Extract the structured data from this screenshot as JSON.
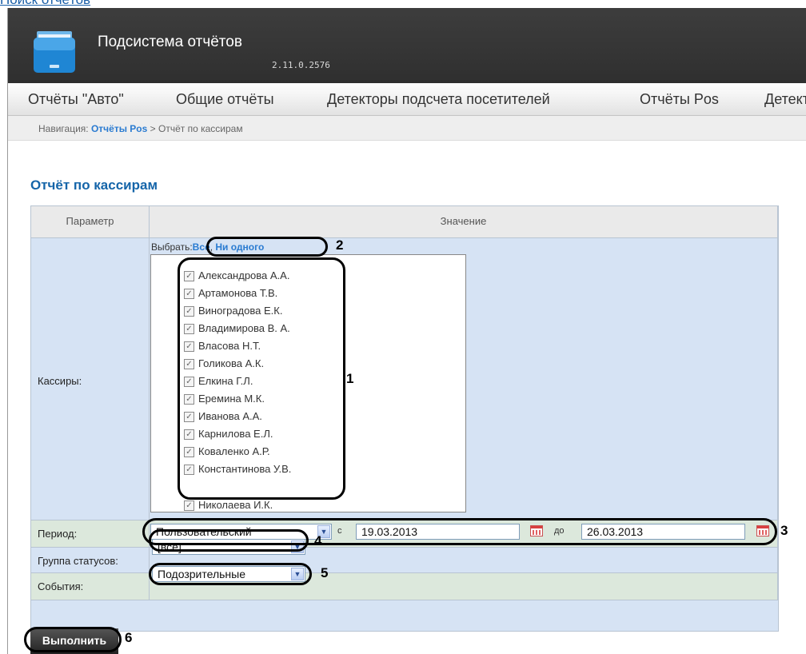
{
  "top_link": "Поиск отчётов",
  "header": {
    "title": "Подсистема отчётов",
    "version": "2.11.0.2576"
  },
  "menu": [
    "Отчёты \"Авто\"",
    "Общие отчёты",
    "Детекторы подсчета посетителей",
    "Отчёты Pos",
    "Детекторы"
  ],
  "breadcrumb": {
    "prefix": "Навигация:",
    "link": "Отчёты Pos",
    "separator": ">",
    "current": "Отчёт по кассирам"
  },
  "page_title": "Отчёт по кассирам",
  "table": {
    "col_param": "Параметр",
    "col_value": "Значение",
    "cashiers_label": "Кассиры:",
    "select_prefix": "Выбрать:",
    "select_all": "Все",
    "select_comma": ",",
    "select_none": "Ни одного",
    "cashiers": [
      "Александрова А.А.",
      "Артамонова Т.В.",
      "Виноградова Е.К.",
      "Владимирова В. А.",
      "Власова Н.Т.",
      "Голикова А.К.",
      "Елкина Г.Л.",
      "Еремина М.К.",
      "Иванова А.А.",
      "Карнилова Е.Л.",
      "Коваленко А.Р.",
      "Константинова У.В.",
      "Николаева И.К."
    ],
    "period_label": "Период:",
    "period_value": "Пользовательский",
    "from_label": "с",
    "date_from": "19.03.2013",
    "to_label": "до",
    "date_to": "26.03.2013",
    "status_group_label": "Группа статусов:",
    "status_group_value": "[все]",
    "events_label": "События:",
    "events_value": "Подозрительные"
  },
  "run_button": "Выполнить",
  "annotations": [
    "1",
    "2",
    "3",
    "4",
    "5",
    "6"
  ]
}
